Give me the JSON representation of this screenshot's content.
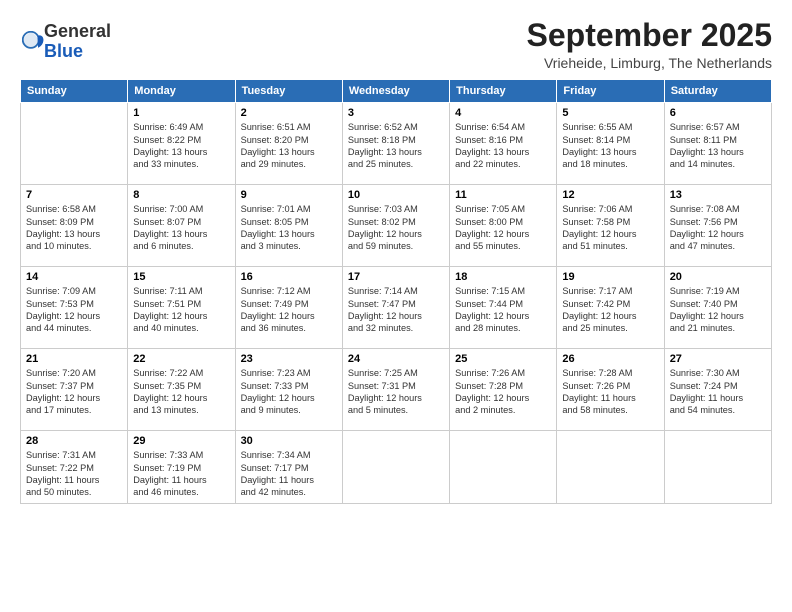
{
  "logo": {
    "general": "General",
    "blue": "Blue"
  },
  "title": "September 2025",
  "location": "Vrieheide, Limburg, The Netherlands",
  "weekdays": [
    "Sunday",
    "Monday",
    "Tuesday",
    "Wednesday",
    "Thursday",
    "Friday",
    "Saturday"
  ],
  "weeks": [
    [
      {
        "day": "",
        "info": ""
      },
      {
        "day": "1",
        "info": "Sunrise: 6:49 AM\nSunset: 8:22 PM\nDaylight: 13 hours\nand 33 minutes."
      },
      {
        "day": "2",
        "info": "Sunrise: 6:51 AM\nSunset: 8:20 PM\nDaylight: 13 hours\nand 29 minutes."
      },
      {
        "day": "3",
        "info": "Sunrise: 6:52 AM\nSunset: 8:18 PM\nDaylight: 13 hours\nand 25 minutes."
      },
      {
        "day": "4",
        "info": "Sunrise: 6:54 AM\nSunset: 8:16 PM\nDaylight: 13 hours\nand 22 minutes."
      },
      {
        "day": "5",
        "info": "Sunrise: 6:55 AM\nSunset: 8:14 PM\nDaylight: 13 hours\nand 18 minutes."
      },
      {
        "day": "6",
        "info": "Sunrise: 6:57 AM\nSunset: 8:11 PM\nDaylight: 13 hours\nand 14 minutes."
      }
    ],
    [
      {
        "day": "7",
        "info": "Sunrise: 6:58 AM\nSunset: 8:09 PM\nDaylight: 13 hours\nand 10 minutes."
      },
      {
        "day": "8",
        "info": "Sunrise: 7:00 AM\nSunset: 8:07 PM\nDaylight: 13 hours\nand 6 minutes."
      },
      {
        "day": "9",
        "info": "Sunrise: 7:01 AM\nSunset: 8:05 PM\nDaylight: 13 hours\nand 3 minutes."
      },
      {
        "day": "10",
        "info": "Sunrise: 7:03 AM\nSunset: 8:02 PM\nDaylight: 12 hours\nand 59 minutes."
      },
      {
        "day": "11",
        "info": "Sunrise: 7:05 AM\nSunset: 8:00 PM\nDaylight: 12 hours\nand 55 minutes."
      },
      {
        "day": "12",
        "info": "Sunrise: 7:06 AM\nSunset: 7:58 PM\nDaylight: 12 hours\nand 51 minutes."
      },
      {
        "day": "13",
        "info": "Sunrise: 7:08 AM\nSunset: 7:56 PM\nDaylight: 12 hours\nand 47 minutes."
      }
    ],
    [
      {
        "day": "14",
        "info": "Sunrise: 7:09 AM\nSunset: 7:53 PM\nDaylight: 12 hours\nand 44 minutes."
      },
      {
        "day": "15",
        "info": "Sunrise: 7:11 AM\nSunset: 7:51 PM\nDaylight: 12 hours\nand 40 minutes."
      },
      {
        "day": "16",
        "info": "Sunrise: 7:12 AM\nSunset: 7:49 PM\nDaylight: 12 hours\nand 36 minutes."
      },
      {
        "day": "17",
        "info": "Sunrise: 7:14 AM\nSunset: 7:47 PM\nDaylight: 12 hours\nand 32 minutes."
      },
      {
        "day": "18",
        "info": "Sunrise: 7:15 AM\nSunset: 7:44 PM\nDaylight: 12 hours\nand 28 minutes."
      },
      {
        "day": "19",
        "info": "Sunrise: 7:17 AM\nSunset: 7:42 PM\nDaylight: 12 hours\nand 25 minutes."
      },
      {
        "day": "20",
        "info": "Sunrise: 7:19 AM\nSunset: 7:40 PM\nDaylight: 12 hours\nand 21 minutes."
      }
    ],
    [
      {
        "day": "21",
        "info": "Sunrise: 7:20 AM\nSunset: 7:37 PM\nDaylight: 12 hours\nand 17 minutes."
      },
      {
        "day": "22",
        "info": "Sunrise: 7:22 AM\nSunset: 7:35 PM\nDaylight: 12 hours\nand 13 minutes."
      },
      {
        "day": "23",
        "info": "Sunrise: 7:23 AM\nSunset: 7:33 PM\nDaylight: 12 hours\nand 9 minutes."
      },
      {
        "day": "24",
        "info": "Sunrise: 7:25 AM\nSunset: 7:31 PM\nDaylight: 12 hours\nand 5 minutes."
      },
      {
        "day": "25",
        "info": "Sunrise: 7:26 AM\nSunset: 7:28 PM\nDaylight: 12 hours\nand 2 minutes."
      },
      {
        "day": "26",
        "info": "Sunrise: 7:28 AM\nSunset: 7:26 PM\nDaylight: 11 hours\nand 58 minutes."
      },
      {
        "day": "27",
        "info": "Sunrise: 7:30 AM\nSunset: 7:24 PM\nDaylight: 11 hours\nand 54 minutes."
      }
    ],
    [
      {
        "day": "28",
        "info": "Sunrise: 7:31 AM\nSunset: 7:22 PM\nDaylight: 11 hours\nand 50 minutes."
      },
      {
        "day": "29",
        "info": "Sunrise: 7:33 AM\nSunset: 7:19 PM\nDaylight: 11 hours\nand 46 minutes."
      },
      {
        "day": "30",
        "info": "Sunrise: 7:34 AM\nSunset: 7:17 PM\nDaylight: 11 hours\nand 42 minutes."
      },
      {
        "day": "",
        "info": ""
      },
      {
        "day": "",
        "info": ""
      },
      {
        "day": "",
        "info": ""
      },
      {
        "day": "",
        "info": ""
      }
    ]
  ]
}
